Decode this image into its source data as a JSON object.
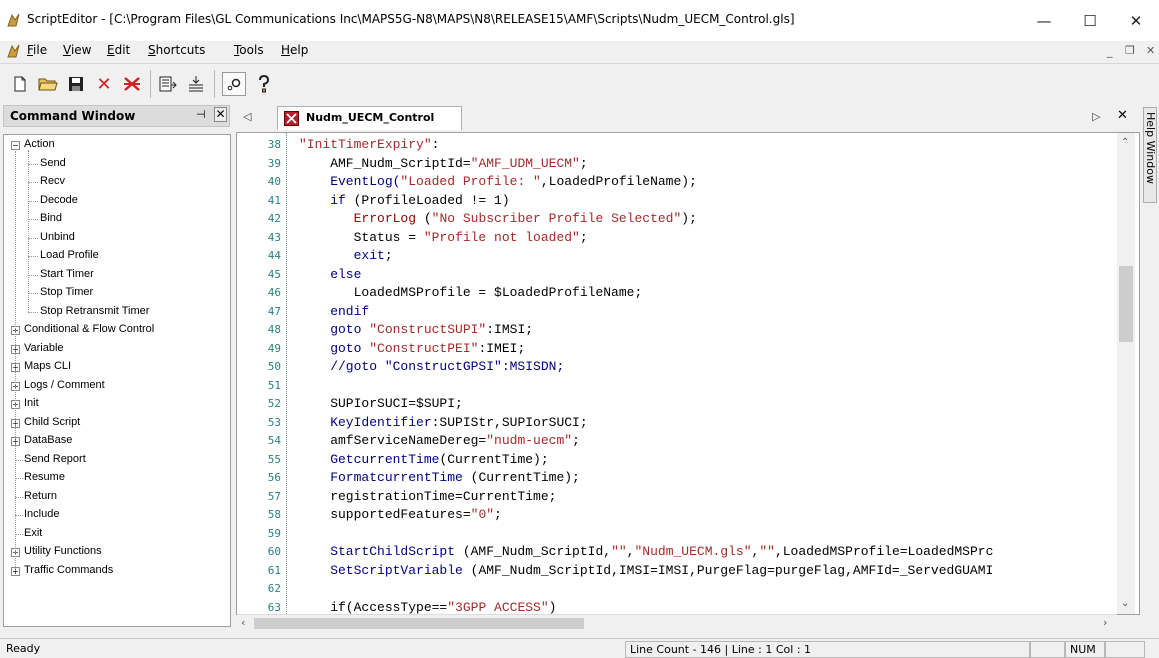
{
  "window": {
    "title": "ScriptEditor - [C:\\Program Files\\GL Communications Inc\\MAPS5G-N8\\MAPS\\N8\\RELEASE15\\AMF\\Scripts\\Nudm_UECM_Control.gls]",
    "minimize": "—",
    "maximize": "☐",
    "close": "✕"
  },
  "menu": [
    "File",
    "View",
    "Edit",
    "Shortcuts",
    "Tools",
    "Help"
  ],
  "toolbar": {
    "icons": [
      "new-file-icon",
      "open-folder-icon",
      "save-icon",
      "delete-icon",
      "delete-all-icon",
      "import-icon",
      "export-icon",
      "tools-icon",
      "help-icon"
    ]
  },
  "command_window": {
    "title": "Command Window",
    "tree": [
      {
        "label": "Action",
        "level": 0,
        "expander": "−"
      },
      {
        "label": "Send",
        "level": 1
      },
      {
        "label": "Recv",
        "level": 1
      },
      {
        "label": "Decode",
        "level": 1
      },
      {
        "label": "Bind",
        "level": 1
      },
      {
        "label": "Unbind",
        "level": 1
      },
      {
        "label": "Load Profile",
        "level": 1
      },
      {
        "label": "Start Timer",
        "level": 1
      },
      {
        "label": "Stop Timer",
        "level": 1
      },
      {
        "label": "Stop Retransmit Timer",
        "level": 1
      },
      {
        "label": "Conditional & Flow Control",
        "level": 0,
        "expander": "+"
      },
      {
        "label": "Variable",
        "level": 0,
        "expander": "+"
      },
      {
        "label": "Maps CLI",
        "level": 0,
        "expander": "+"
      },
      {
        "label": "Logs / Comment",
        "level": 0,
        "expander": "+"
      },
      {
        "label": "Init",
        "level": 0,
        "expander": "+"
      },
      {
        "label": "Child Script",
        "level": 0,
        "expander": "+"
      },
      {
        "label": "DataBase",
        "level": 0,
        "expander": "+"
      },
      {
        "label": "Send Report",
        "level": 0
      },
      {
        "label": "Resume",
        "level": 0
      },
      {
        "label": "Return",
        "level": 0
      },
      {
        "label": "Include",
        "level": 0
      },
      {
        "label": "Exit",
        "level": 0
      },
      {
        "label": "Utility Functions",
        "level": 0,
        "expander": "+"
      },
      {
        "label": "Traffic Commands",
        "level": 0,
        "expander": "+"
      }
    ]
  },
  "editor_tab": {
    "label": "Nudm_UECM_Control"
  },
  "code": {
    "line_numbers": [
      "38",
      "39",
      "40",
      "41",
      "42",
      "43",
      "44",
      "45",
      "46",
      "47",
      "48",
      "49",
      "50",
      "51",
      "52",
      "53",
      "54",
      "55",
      "56",
      "57",
      "58",
      "59",
      "60",
      "61",
      "62",
      "63"
    ],
    "lines": [
      [
        {
          "t": "\"InitTimerExpiry\"",
          "c": "s"
        },
        {
          "t": ":",
          "c": ""
        }
      ],
      [
        {
          "t": "    AMF_Nudm_ScriptId=",
          "c": ""
        },
        {
          "t": "\"AMF_UDM_UECM\"",
          "c": "s"
        },
        {
          "t": ";",
          "c": ""
        }
      ],
      [
        {
          "t": "    EventLog(",
          "c": "k"
        },
        {
          "t": "\"Loaded Profile: \"",
          "c": "s"
        },
        {
          "t": ",LoadedProfileName);",
          "c": ""
        }
      ],
      [
        {
          "t": "    if",
          "c": "k"
        },
        {
          "t": " (ProfileLoaded != 1)",
          "c": ""
        }
      ],
      [
        {
          "t": "       ErrorLog ",
          "c": "e"
        },
        {
          "t": "(",
          "c": ""
        },
        {
          "t": "\"No Subscriber Profile Selected\"",
          "c": "s"
        },
        {
          "t": ");",
          "c": ""
        }
      ],
      [
        {
          "t": "       Status = ",
          "c": ""
        },
        {
          "t": "\"Profile not loaded\"",
          "c": "s"
        },
        {
          "t": ";",
          "c": ""
        }
      ],
      [
        {
          "t": "       exit",
          "c": "k"
        },
        {
          "t": ";",
          "c": ""
        }
      ],
      [
        {
          "t": "    else",
          "c": "k"
        }
      ],
      [
        {
          "t": "       LoadedMSProfile = $LoadedProfileName;",
          "c": ""
        }
      ],
      [
        {
          "t": "    endif",
          "c": "k"
        }
      ],
      [
        {
          "t": "    goto ",
          "c": "k"
        },
        {
          "t": "\"ConstructSUPI\"",
          "c": "s"
        },
        {
          "t": ":IMSI;",
          "c": ""
        }
      ],
      [
        {
          "t": "    goto ",
          "c": "k"
        },
        {
          "t": "\"ConstructPEI\"",
          "c": "s"
        },
        {
          "t": ":IMEI;",
          "c": ""
        }
      ],
      [
        {
          "t": "    //goto \"ConstructGPSI\":MSISDN;",
          "c": "k"
        }
      ],
      [
        {
          "t": "",
          "c": ""
        }
      ],
      [
        {
          "t": "    SUPIorSUCI=$SUPI;",
          "c": ""
        }
      ],
      [
        {
          "t": "    KeyIdentifier",
          "c": "k"
        },
        {
          "t": ":SUPIStr,SUPIorSUCI;",
          "c": ""
        }
      ],
      [
        {
          "t": "    amfServiceNameDereg=",
          "c": ""
        },
        {
          "t": "\"nudm-uecm\"",
          "c": "s"
        },
        {
          "t": ";",
          "c": ""
        }
      ],
      [
        {
          "t": "    GetcurrentTime",
          "c": "k"
        },
        {
          "t": "(CurrentTime);",
          "c": ""
        }
      ],
      [
        {
          "t": "    FormatcurrentTime ",
          "c": "k"
        },
        {
          "t": "(CurrentTime);",
          "c": ""
        }
      ],
      [
        {
          "t": "    registrationTime=CurrentTime;",
          "c": ""
        }
      ],
      [
        {
          "t": "    supportedFeatures=",
          "c": ""
        },
        {
          "t": "\"0\"",
          "c": "s"
        },
        {
          "t": ";",
          "c": ""
        }
      ],
      [
        {
          "t": "",
          "c": ""
        }
      ],
      [
        {
          "t": "    StartChildScript ",
          "c": "k"
        },
        {
          "t": "(AMF_Nudm_ScriptId,",
          "c": ""
        },
        {
          "t": "\"\"",
          "c": "s"
        },
        {
          "t": ",",
          "c": ""
        },
        {
          "t": "\"Nudm_UECM.gls\"",
          "c": "s"
        },
        {
          "t": ",",
          "c": ""
        },
        {
          "t": "\"\"",
          "c": "s"
        },
        {
          "t": ",LoadedMSProfile=LoadedMSPrc",
          "c": ""
        }
      ],
      [
        {
          "t": "    SetScriptVariable ",
          "c": "k"
        },
        {
          "t": "(AMF_Nudm_ScriptId,IMSI=IMSI,PurgeFlag=purgeFlag,AMFId=_ServedGUAMI",
          "c": ""
        }
      ],
      [
        {
          "t": "",
          "c": ""
        }
      ],
      [
        {
          "t": "    if(AccessType==",
          "c": ""
        },
        {
          "t": "\"3GPP ACCESS\"",
          "c": "s"
        },
        {
          "t": ")",
          "c": ""
        }
      ]
    ]
  },
  "status": {
    "ready": "Ready",
    "line_info": "Line Count - 146 | Line : 1 Col : 1",
    "num": "NUM"
  },
  "help_window": {
    "label": "Help Window"
  }
}
